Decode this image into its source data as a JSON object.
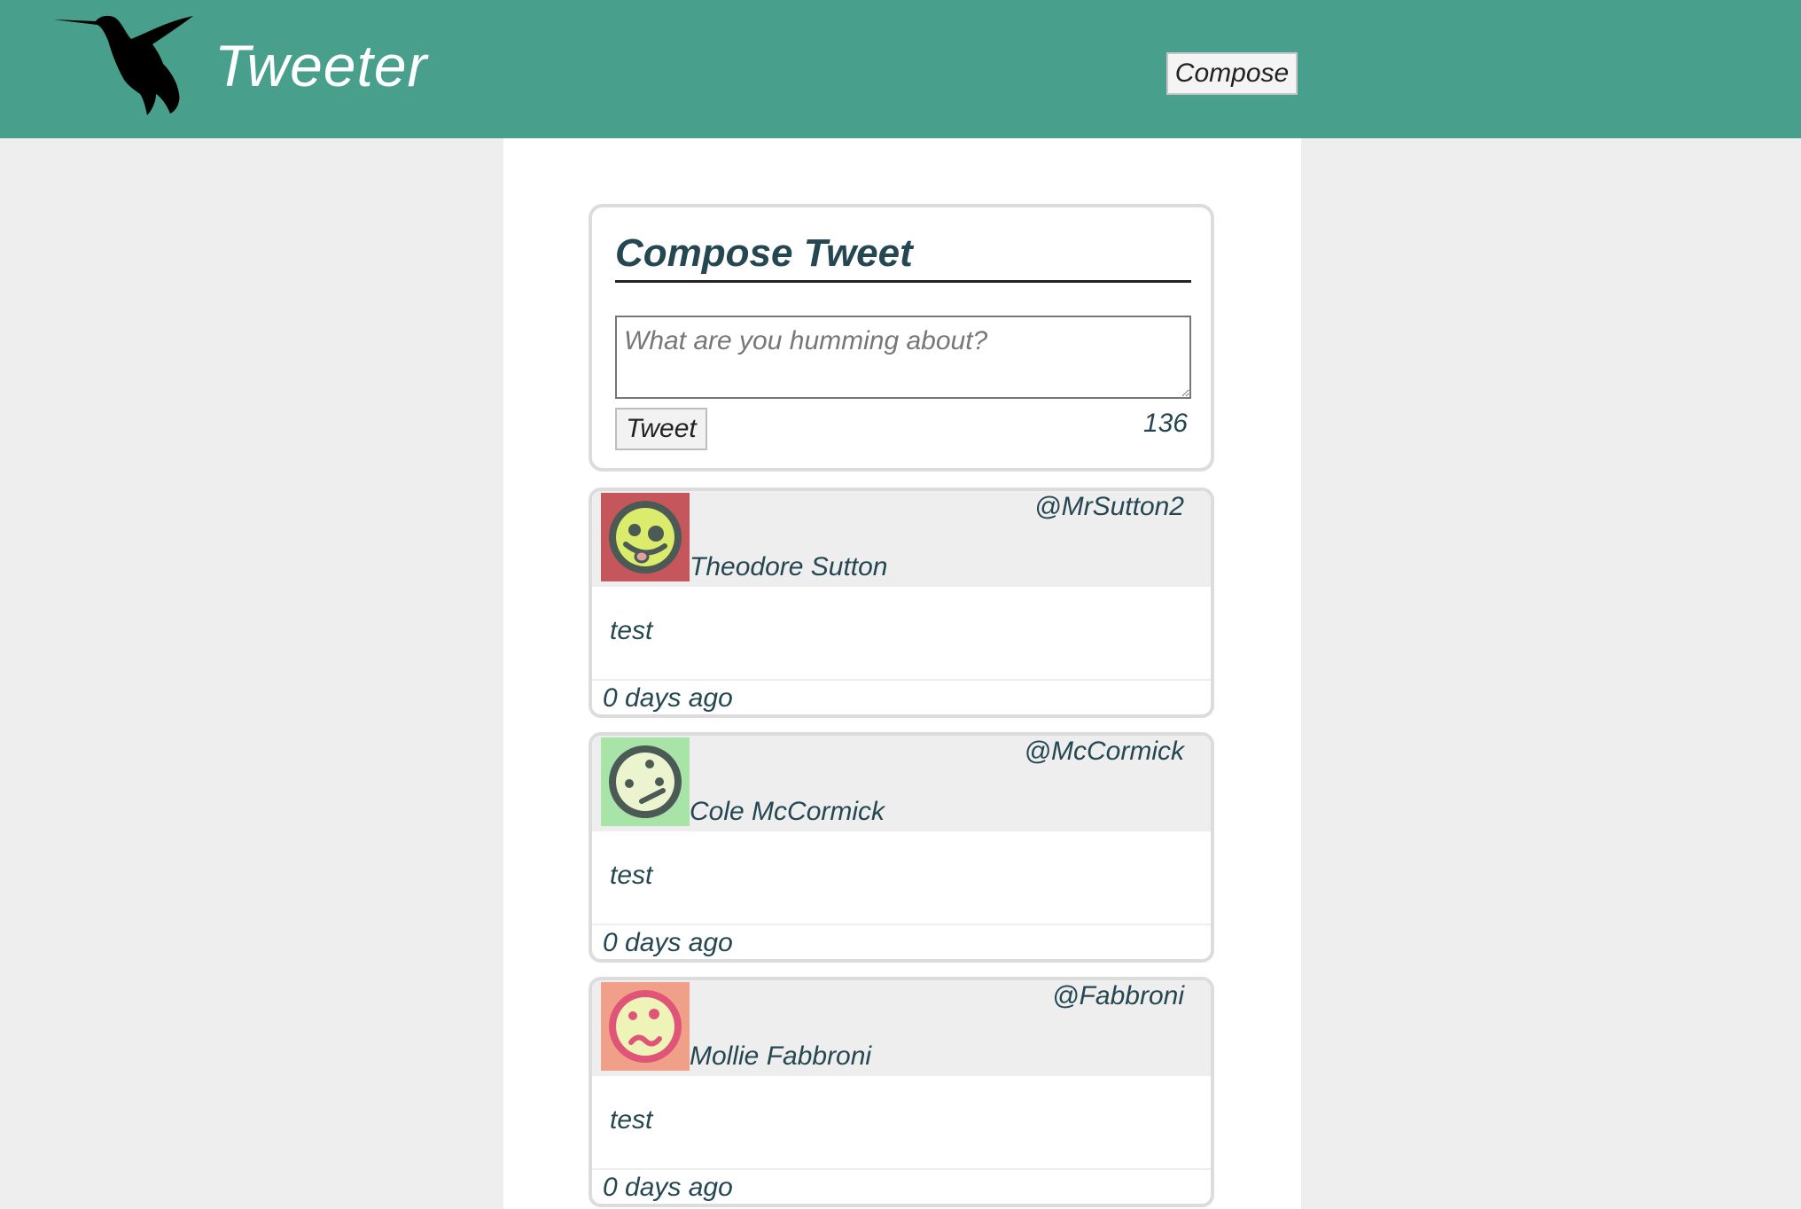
{
  "header": {
    "brand": "Tweeter",
    "compose_label": "Compose",
    "logo_icon": "hummingbird-icon",
    "background_color": "#489f8b"
  },
  "compose": {
    "title": "Compose Tweet",
    "placeholder": "What are you humming about?",
    "value": "",
    "tweet_label": "Tweet",
    "char_count": "136"
  },
  "tweets": [
    {
      "name": "Theodore Sutton",
      "handle": "@MrSutton2",
      "text": "test",
      "time": "0 days ago",
      "avatar": {
        "icon": "tongue-smiley-avatar-icon",
        "bg": "#c4565c",
        "face": "#dbeb6b",
        "ink": "#4b5a55"
      }
    },
    {
      "name": "Cole McCormick",
      "handle": "@McCormick",
      "text": "test",
      "time": "0 days ago",
      "avatar": {
        "icon": "smirk-smiley-avatar-icon",
        "bg": "#a8e3a8",
        "face": "#ecf3cf",
        "ink": "#4b5a55"
      }
    },
    {
      "name": "Mollie Fabbroni",
      "handle": "@Fabbroni",
      "text": "test",
      "time": "0 days ago",
      "avatar": {
        "icon": "wavy-smiley-avatar-icon",
        "bg": "#f0a088",
        "face": "#eef3b8",
        "ink": "#e05478"
      }
    }
  ]
}
